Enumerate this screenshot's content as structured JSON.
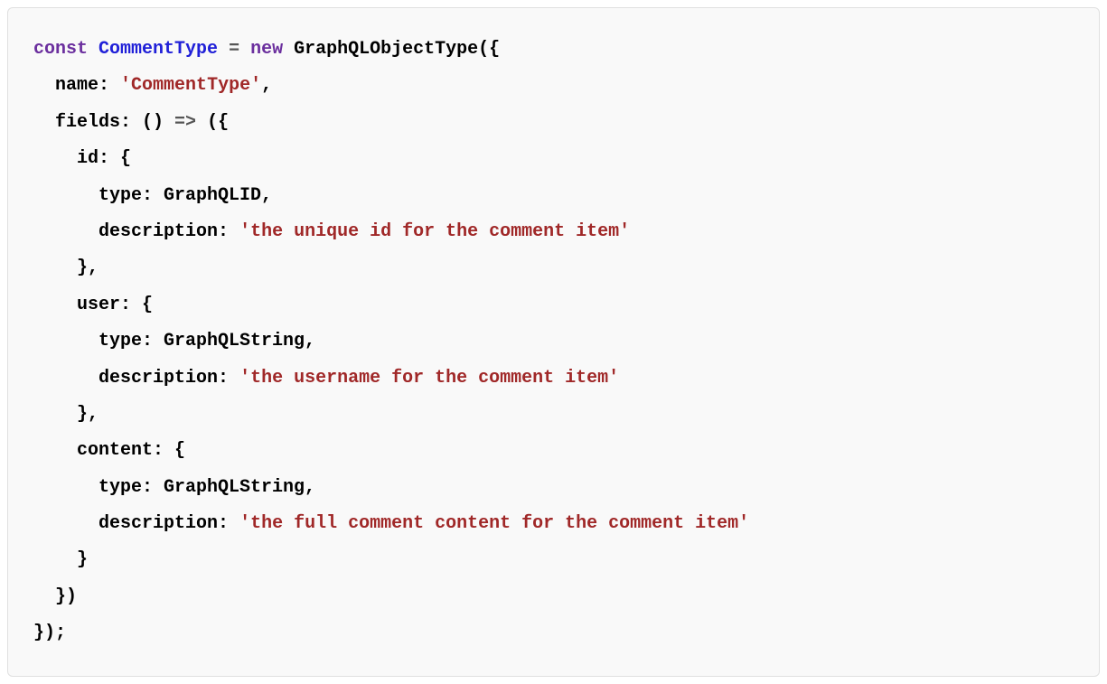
{
  "code": {
    "line1": {
      "kw_const": "const",
      "var": "CommentType",
      "eq": " = ",
      "kw_new": "new",
      "call": " GraphQLObjectType({"
    },
    "line2": {
      "indent": "  ",
      "prop": "name:",
      "space": " ",
      "str": "'CommentType'",
      "tail": ","
    },
    "line3": {
      "indent": "  ",
      "prop": "fields:",
      "space": " () ",
      "arrow": "=>",
      "tail": " ({"
    },
    "line4": {
      "indent": "    ",
      "prop": "id:",
      "tail": " {"
    },
    "line5": {
      "indent": "      ",
      "prop": "type:",
      "tail": " GraphQLID,"
    },
    "line6": {
      "indent": "      ",
      "prop": "description:",
      "space": " ",
      "str": "'the unique id for the comment item'"
    },
    "line7": {
      "indent": "    ",
      "tail": "},"
    },
    "line8": {
      "indent": "    ",
      "prop": "user:",
      "tail": " {"
    },
    "line9": {
      "indent": "      ",
      "prop": "type:",
      "tail": " GraphQLString,"
    },
    "line10": {
      "indent": "      ",
      "prop": "description:",
      "space": " ",
      "str": "'the username for the comment item'"
    },
    "line11": {
      "indent": "    ",
      "tail": "},"
    },
    "line12": {
      "indent": "    ",
      "prop": "content:",
      "tail": " {"
    },
    "line13": {
      "indent": "      ",
      "prop": "type:",
      "tail": " GraphQLString,"
    },
    "line14": {
      "indent": "      ",
      "prop": "description:",
      "space": " ",
      "str": "'the full comment content for the comment item'"
    },
    "line15": {
      "indent": "    ",
      "tail": "}"
    },
    "line16": {
      "indent": "  ",
      "tail": "})"
    },
    "line17": {
      "tail": "});"
    }
  }
}
